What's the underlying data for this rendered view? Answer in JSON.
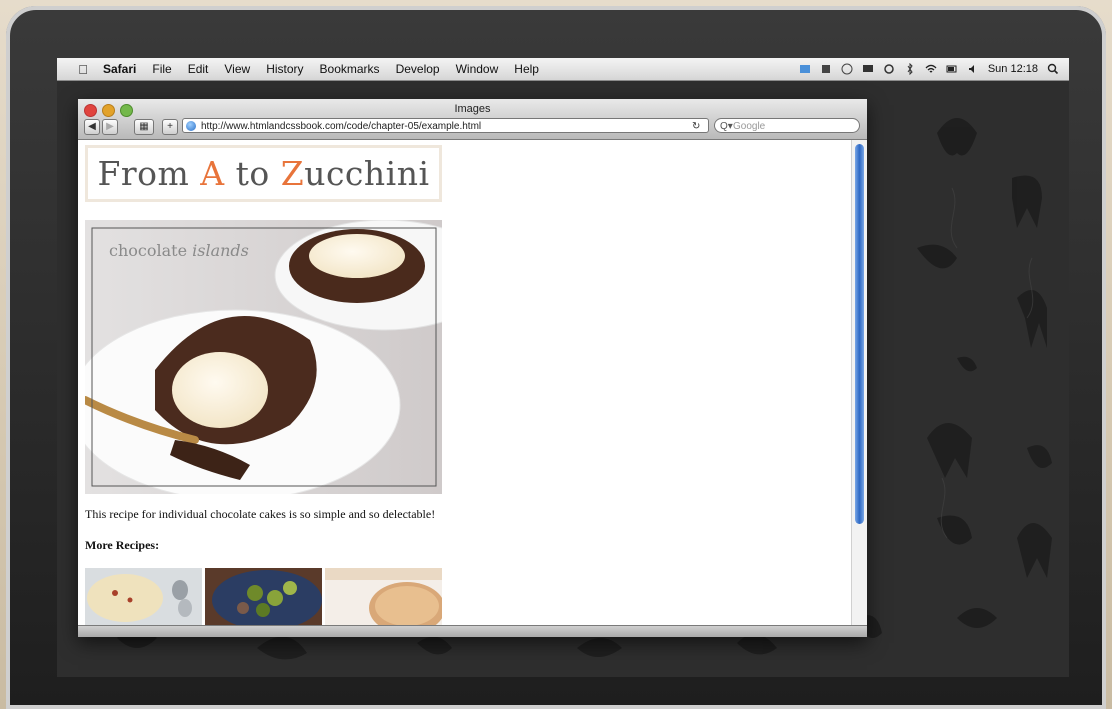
{
  "menubar": {
    "app": "Safari",
    "items": [
      "File",
      "Edit",
      "View",
      "History",
      "Bookmarks",
      "Develop",
      "Window",
      "Help"
    ],
    "clock": "Sun 12:18"
  },
  "window": {
    "title": "Images",
    "url": "http://www.htmlandcssbook.com/code/chapter-05/example.html",
    "search_placeholder": "Google"
  },
  "page": {
    "logo_parts": [
      "From ",
      "A",
      " to ",
      "Z",
      "ucchini"
    ],
    "hero_overlay_plain": "chocolate ",
    "hero_overlay_script": "islands",
    "caption": "This recipe for individual chocolate cakes is so simple and so delectable!",
    "more_recipes": "More Recipes:"
  },
  "colors": {
    "accent": "#e8743b",
    "logo_text": "#555555",
    "scroll_thumb": "#2d68c4"
  },
  "icons": [
    "apple-icon",
    "back-icon",
    "forward-icon",
    "bookmark-icon",
    "add-icon",
    "globe-icon",
    "reload-icon",
    "search-icon"
  ]
}
